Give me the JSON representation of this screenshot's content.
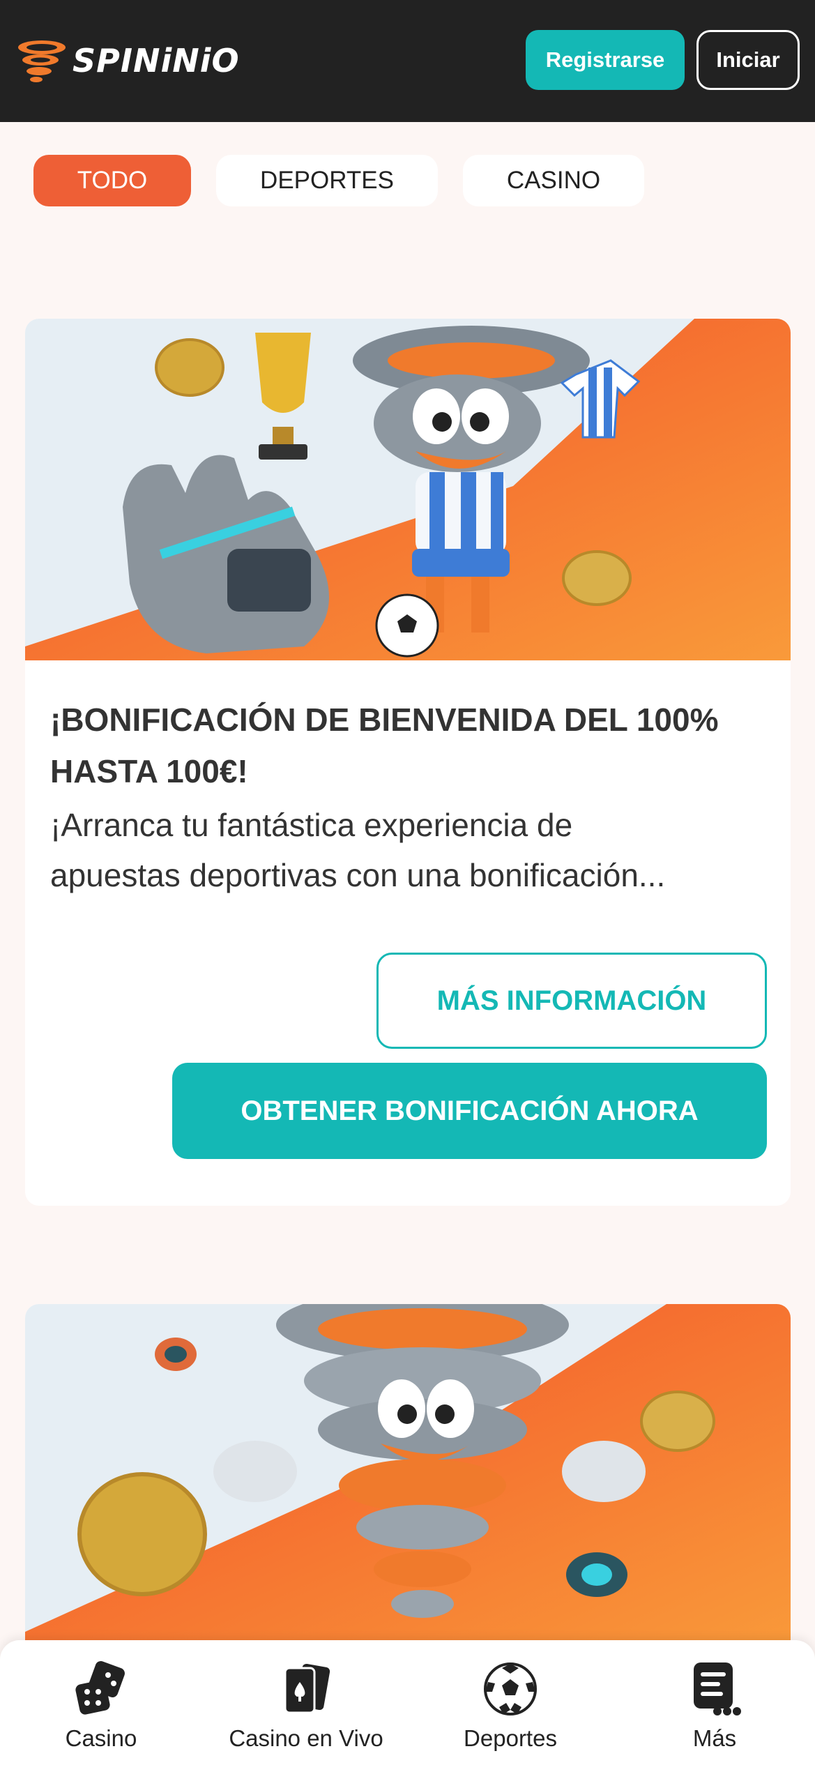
{
  "header": {
    "brand": "SPINiNiO",
    "register_label": "Registrarse",
    "login_label": "Iniciar"
  },
  "filters": [
    {
      "label": "TODO",
      "active": true
    },
    {
      "label": "DEPORTES",
      "active": false
    },
    {
      "label": "CASINO",
      "active": false
    }
  ],
  "promos": [
    {
      "title": "¡BONIFICACIÓN DE BIENVENIDA DEL 100% HASTA 100€!",
      "description_line1": "¡Arranca tu fantástica experiencia de",
      "description_line2": "apuestas deportivas con una bonificación...",
      "more_info_label": "MÁS INFORMACIÓN",
      "claim_label": "OBTENER BONIFICACIÓN AHORA",
      "image": "sports-tornado-mascot-with-trophy-and-ball"
    },
    {
      "image": "casino-tornado-mascot-with-coins-and-chips"
    }
  ],
  "bottom_nav": [
    {
      "label": "Casino",
      "icon": "dice-icon"
    },
    {
      "label": "Casino en Vivo",
      "icon": "playing-cards-icon"
    },
    {
      "label": "Deportes",
      "icon": "soccer-ball-icon"
    },
    {
      "label": "Más",
      "icon": "more-icon"
    }
  ],
  "colors": {
    "header_bg": "#222222",
    "accent_teal": "#14b8b5",
    "accent_orange": "#ee5f36",
    "page_bg": "#fdf6f4"
  }
}
